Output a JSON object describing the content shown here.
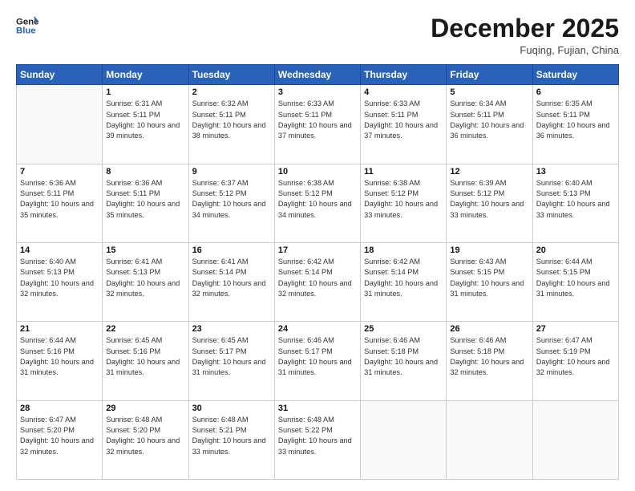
{
  "header": {
    "logo_line1": "General",
    "logo_line2": "Blue",
    "month": "December 2025",
    "location": "Fuqing, Fujian, China"
  },
  "days_of_week": [
    "Sunday",
    "Monday",
    "Tuesday",
    "Wednesday",
    "Thursday",
    "Friday",
    "Saturday"
  ],
  "weeks": [
    [
      {
        "day": "",
        "sunrise": "",
        "sunset": "",
        "daylight": ""
      },
      {
        "day": "1",
        "sunrise": "Sunrise: 6:31 AM",
        "sunset": "Sunset: 5:11 PM",
        "daylight": "Daylight: 10 hours and 39 minutes."
      },
      {
        "day": "2",
        "sunrise": "Sunrise: 6:32 AM",
        "sunset": "Sunset: 5:11 PM",
        "daylight": "Daylight: 10 hours and 38 minutes."
      },
      {
        "day": "3",
        "sunrise": "Sunrise: 6:33 AM",
        "sunset": "Sunset: 5:11 PM",
        "daylight": "Daylight: 10 hours and 37 minutes."
      },
      {
        "day": "4",
        "sunrise": "Sunrise: 6:33 AM",
        "sunset": "Sunset: 5:11 PM",
        "daylight": "Daylight: 10 hours and 37 minutes."
      },
      {
        "day": "5",
        "sunrise": "Sunrise: 6:34 AM",
        "sunset": "Sunset: 5:11 PM",
        "daylight": "Daylight: 10 hours and 36 minutes."
      },
      {
        "day": "6",
        "sunrise": "Sunrise: 6:35 AM",
        "sunset": "Sunset: 5:11 PM",
        "daylight": "Daylight: 10 hours and 36 minutes."
      }
    ],
    [
      {
        "day": "7",
        "sunrise": "Sunrise: 6:36 AM",
        "sunset": "Sunset: 5:11 PM",
        "daylight": "Daylight: 10 hours and 35 minutes."
      },
      {
        "day": "8",
        "sunrise": "Sunrise: 6:36 AM",
        "sunset": "Sunset: 5:11 PM",
        "daylight": "Daylight: 10 hours and 35 minutes."
      },
      {
        "day": "9",
        "sunrise": "Sunrise: 6:37 AM",
        "sunset": "Sunset: 5:12 PM",
        "daylight": "Daylight: 10 hours and 34 minutes."
      },
      {
        "day": "10",
        "sunrise": "Sunrise: 6:38 AM",
        "sunset": "Sunset: 5:12 PM",
        "daylight": "Daylight: 10 hours and 34 minutes."
      },
      {
        "day": "11",
        "sunrise": "Sunrise: 6:38 AM",
        "sunset": "Sunset: 5:12 PM",
        "daylight": "Daylight: 10 hours and 33 minutes."
      },
      {
        "day": "12",
        "sunrise": "Sunrise: 6:39 AM",
        "sunset": "Sunset: 5:12 PM",
        "daylight": "Daylight: 10 hours and 33 minutes."
      },
      {
        "day": "13",
        "sunrise": "Sunrise: 6:40 AM",
        "sunset": "Sunset: 5:13 PM",
        "daylight": "Daylight: 10 hours and 33 minutes."
      }
    ],
    [
      {
        "day": "14",
        "sunrise": "Sunrise: 6:40 AM",
        "sunset": "Sunset: 5:13 PM",
        "daylight": "Daylight: 10 hours and 32 minutes."
      },
      {
        "day": "15",
        "sunrise": "Sunrise: 6:41 AM",
        "sunset": "Sunset: 5:13 PM",
        "daylight": "Daylight: 10 hours and 32 minutes."
      },
      {
        "day": "16",
        "sunrise": "Sunrise: 6:41 AM",
        "sunset": "Sunset: 5:14 PM",
        "daylight": "Daylight: 10 hours and 32 minutes."
      },
      {
        "day": "17",
        "sunrise": "Sunrise: 6:42 AM",
        "sunset": "Sunset: 5:14 PM",
        "daylight": "Daylight: 10 hours and 32 minutes."
      },
      {
        "day": "18",
        "sunrise": "Sunrise: 6:42 AM",
        "sunset": "Sunset: 5:14 PM",
        "daylight": "Daylight: 10 hours and 31 minutes."
      },
      {
        "day": "19",
        "sunrise": "Sunrise: 6:43 AM",
        "sunset": "Sunset: 5:15 PM",
        "daylight": "Daylight: 10 hours and 31 minutes."
      },
      {
        "day": "20",
        "sunrise": "Sunrise: 6:44 AM",
        "sunset": "Sunset: 5:15 PM",
        "daylight": "Daylight: 10 hours and 31 minutes."
      }
    ],
    [
      {
        "day": "21",
        "sunrise": "Sunrise: 6:44 AM",
        "sunset": "Sunset: 5:16 PM",
        "daylight": "Daylight: 10 hours and 31 minutes."
      },
      {
        "day": "22",
        "sunrise": "Sunrise: 6:45 AM",
        "sunset": "Sunset: 5:16 PM",
        "daylight": "Daylight: 10 hours and 31 minutes."
      },
      {
        "day": "23",
        "sunrise": "Sunrise: 6:45 AM",
        "sunset": "Sunset: 5:17 PM",
        "daylight": "Daylight: 10 hours and 31 minutes."
      },
      {
        "day": "24",
        "sunrise": "Sunrise: 6:46 AM",
        "sunset": "Sunset: 5:17 PM",
        "daylight": "Daylight: 10 hours and 31 minutes."
      },
      {
        "day": "25",
        "sunrise": "Sunrise: 6:46 AM",
        "sunset": "Sunset: 5:18 PM",
        "daylight": "Daylight: 10 hours and 31 minutes."
      },
      {
        "day": "26",
        "sunrise": "Sunrise: 6:46 AM",
        "sunset": "Sunset: 5:18 PM",
        "daylight": "Daylight: 10 hours and 32 minutes."
      },
      {
        "day": "27",
        "sunrise": "Sunrise: 6:47 AM",
        "sunset": "Sunset: 5:19 PM",
        "daylight": "Daylight: 10 hours and 32 minutes."
      }
    ],
    [
      {
        "day": "28",
        "sunrise": "Sunrise: 6:47 AM",
        "sunset": "Sunset: 5:20 PM",
        "daylight": "Daylight: 10 hours and 32 minutes."
      },
      {
        "day": "29",
        "sunrise": "Sunrise: 6:48 AM",
        "sunset": "Sunset: 5:20 PM",
        "daylight": "Daylight: 10 hours and 32 minutes."
      },
      {
        "day": "30",
        "sunrise": "Sunrise: 6:48 AM",
        "sunset": "Sunset: 5:21 PM",
        "daylight": "Daylight: 10 hours and 33 minutes."
      },
      {
        "day": "31",
        "sunrise": "Sunrise: 6:48 AM",
        "sunset": "Sunset: 5:22 PM",
        "daylight": "Daylight: 10 hours and 33 minutes."
      },
      {
        "day": "",
        "sunrise": "",
        "sunset": "",
        "daylight": ""
      },
      {
        "day": "",
        "sunrise": "",
        "sunset": "",
        "daylight": ""
      },
      {
        "day": "",
        "sunrise": "",
        "sunset": "",
        "daylight": ""
      }
    ]
  ]
}
